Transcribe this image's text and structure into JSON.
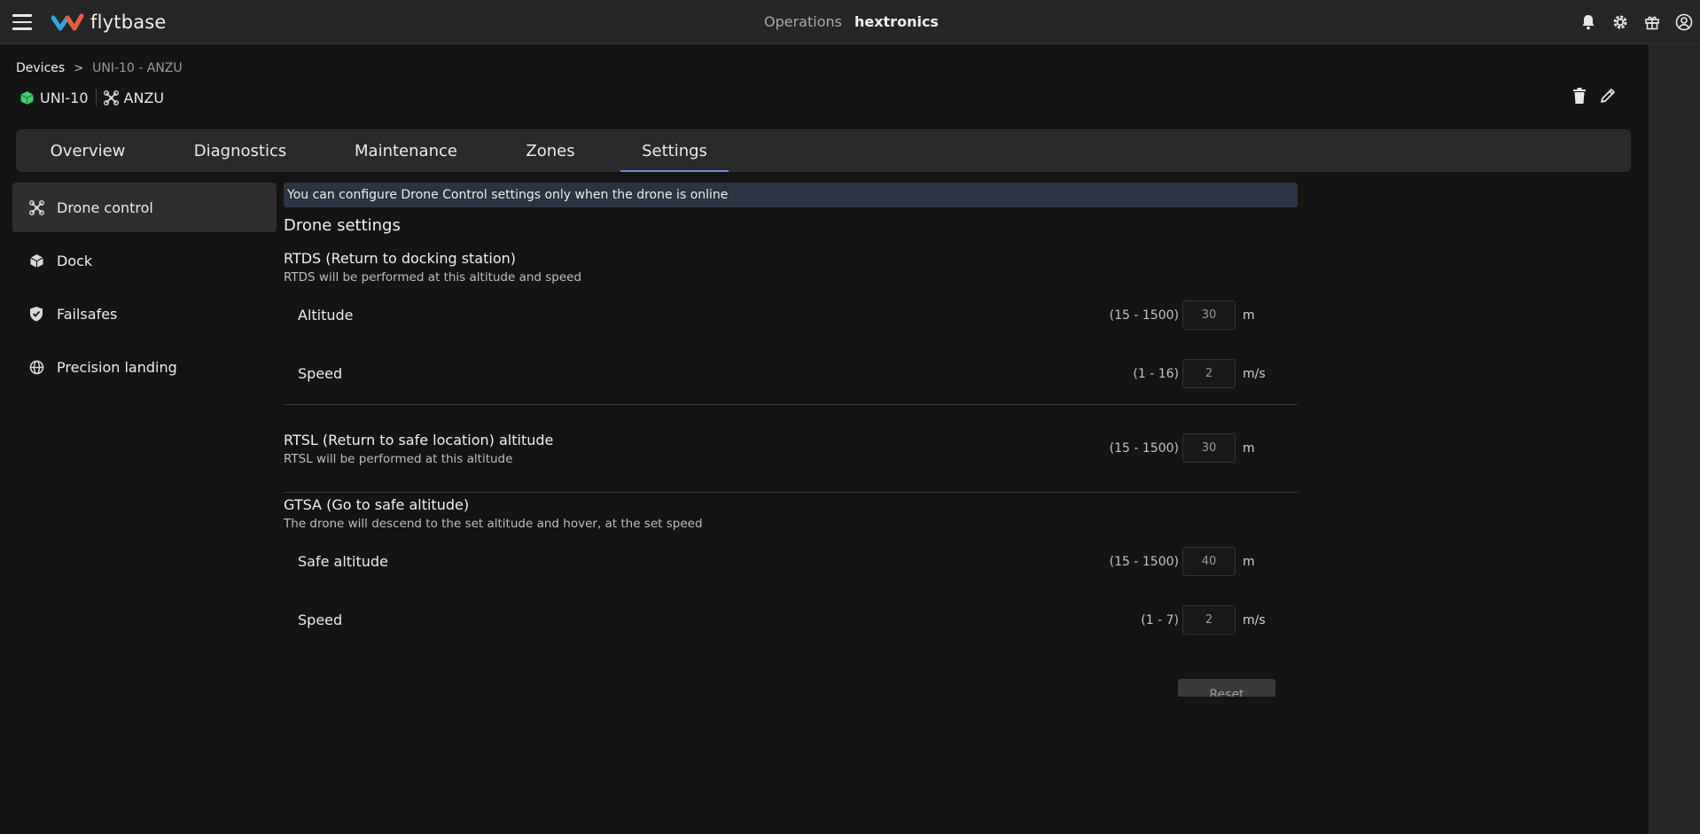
{
  "topbar": {
    "logo_text": "flytbase",
    "operations_label": "Operations",
    "org_name": "hextronics",
    "icons": [
      "bell-icon",
      "gear-icon",
      "gift-icon",
      "user-icon"
    ]
  },
  "breadcrumb": {
    "root": "Devices",
    "separator": ">",
    "current": "UNI-10 - ANZU"
  },
  "device": {
    "dock_name": "UNI-10",
    "drone_name": "ANZU",
    "dock_icon_color": "#3ecf6e"
  },
  "tabs": [
    {
      "label": "Overview"
    },
    {
      "label": "Diagnostics"
    },
    {
      "label": "Maintenance"
    },
    {
      "label": "Zones"
    },
    {
      "label": "Settings",
      "active": true
    }
  ],
  "sidebar": {
    "items": [
      {
        "label": "Drone control",
        "icon": "drone-icon",
        "active": true
      },
      {
        "label": "Dock",
        "icon": "box-icon"
      },
      {
        "label": "Failsafes",
        "icon": "shield-check-icon"
      },
      {
        "label": "Precision landing",
        "icon": "globe-icon"
      }
    ]
  },
  "content": {
    "banner": "You can configure Drone Control settings only when the drone is online",
    "section_title": "Drone settings",
    "rtds": {
      "title": "RTDS (Return to docking station)",
      "desc": "RTDS will be performed at this altitude and speed",
      "altitude": {
        "label": "Altitude",
        "range": "(15 - 1500)",
        "value": "30",
        "unit": "m"
      },
      "speed": {
        "label": "Speed",
        "range": "(1 - 16)",
        "value": "2",
        "unit": "m/s"
      }
    },
    "rtsl": {
      "title": "RTSL (Return to safe location) altitude",
      "desc": "RTSL will be performed at this altitude",
      "range": "(15 - 1500)",
      "value": "30",
      "unit": "m"
    },
    "gtsa": {
      "title": "GTSA (Go to safe altitude)",
      "desc": "The drone will descend to the set altitude and hover, at the set speed",
      "altitude": {
        "label": "Safe altitude",
        "range": "(15 - 1500)",
        "value": "40",
        "unit": "m"
      },
      "speed": {
        "label": "Speed",
        "range": "(1 - 7)",
        "value": "2",
        "unit": "m/s"
      }
    },
    "reset_label": "Reset"
  }
}
